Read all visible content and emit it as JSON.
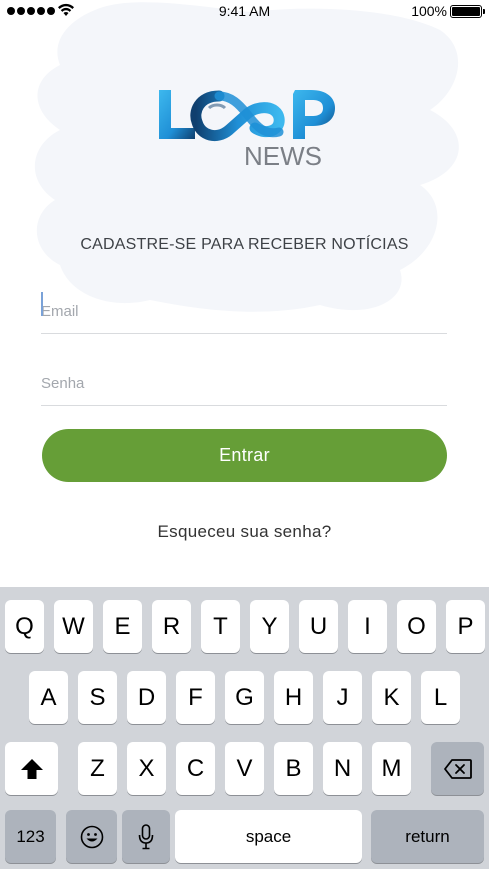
{
  "status_bar": {
    "time": "9:41 AM",
    "battery": "100%",
    "signal_icon": "signal-dots-icon",
    "wifi_icon": "wifi-icon",
    "battery_icon": "battery-icon"
  },
  "logo": {
    "wordmark": "LOOP",
    "subtitle": "NEWS",
    "colors": {
      "primary": "#1f8fd6",
      "light": "#3db8ee",
      "dark": "#0f3f6e"
    }
  },
  "form": {
    "heading": "CADASTRE-SE PARA RECEBER NOTÍCIAS",
    "email_placeholder": "Email",
    "password_placeholder": "Senha",
    "submit_label": "Entrar",
    "forgot_label": "Esqueceu sua senha?"
  },
  "colors": {
    "button": "#669e37",
    "keyboard_bg": "#d1d4d9"
  },
  "keyboard": {
    "row1": [
      "Q",
      "W",
      "E",
      "R",
      "T",
      "Y",
      "U",
      "I",
      "O",
      "P"
    ],
    "row2": [
      "A",
      "S",
      "D",
      "F",
      "G",
      "H",
      "J",
      "K",
      "L"
    ],
    "row3": [
      "Z",
      "X",
      "C",
      "V",
      "B",
      "N",
      "M"
    ],
    "shift_icon": "shift-arrow-icon",
    "backspace_icon": "backspace-icon",
    "numbers_label": "123",
    "emoji_icon": "emoji-icon",
    "mic_icon": "microphone-icon",
    "space_label": "space",
    "return_label": "return"
  }
}
